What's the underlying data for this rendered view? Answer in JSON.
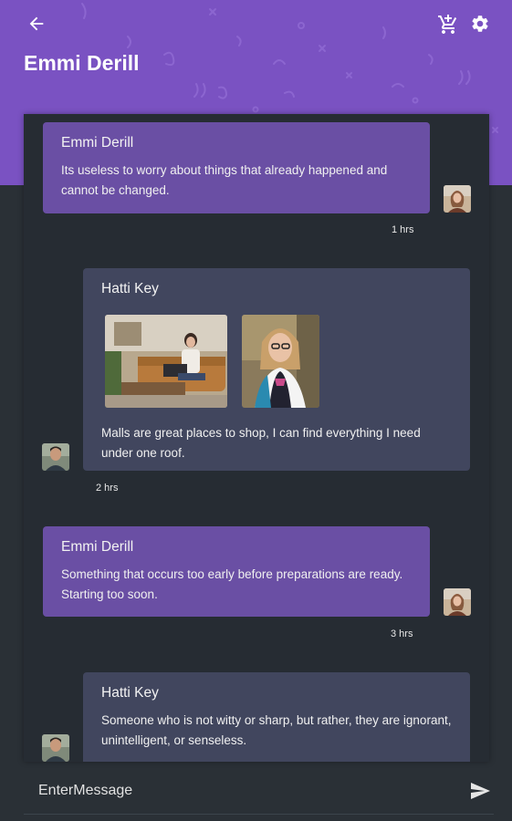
{
  "header": {
    "title": "Emmi Derill",
    "back_icon": "arrow-left-icon",
    "cart_icon": "cart-plus-icon",
    "settings_icon": "gear-icon",
    "background_color": "#7a52c2"
  },
  "messages": [
    {
      "sender": "Emmi Derill",
      "text": "Its useless to worry about things that already happened and cannot be changed.",
      "time": "1 hrs",
      "side": "right"
    },
    {
      "sender": "Hatti Key",
      "text": "Malls are great places to shop, I can find everything I need under one roof.",
      "time": "2 hrs",
      "side": "left",
      "attachments": [
        "photo-woman-laptop",
        "photo-woman-glasses"
      ]
    },
    {
      "sender": "Emmi Derill",
      "text": "Something that occurs too early before preparations are ready. Starting too soon.",
      "time": "3 hrs",
      "side": "right"
    },
    {
      "sender": "Hatti Key",
      "text": "Someone who is not witty or sharp, but rather, they are ignorant, unintelligent, or senseless.",
      "side": "left"
    }
  ],
  "composer": {
    "placeholder": "EnterMessage",
    "send_icon": "send-icon"
  },
  "colors": {
    "accent": "#7a52c2",
    "my_bubble": "#6a4fa4",
    "their_bubble": "#41465e",
    "background": "#2a3036"
  }
}
